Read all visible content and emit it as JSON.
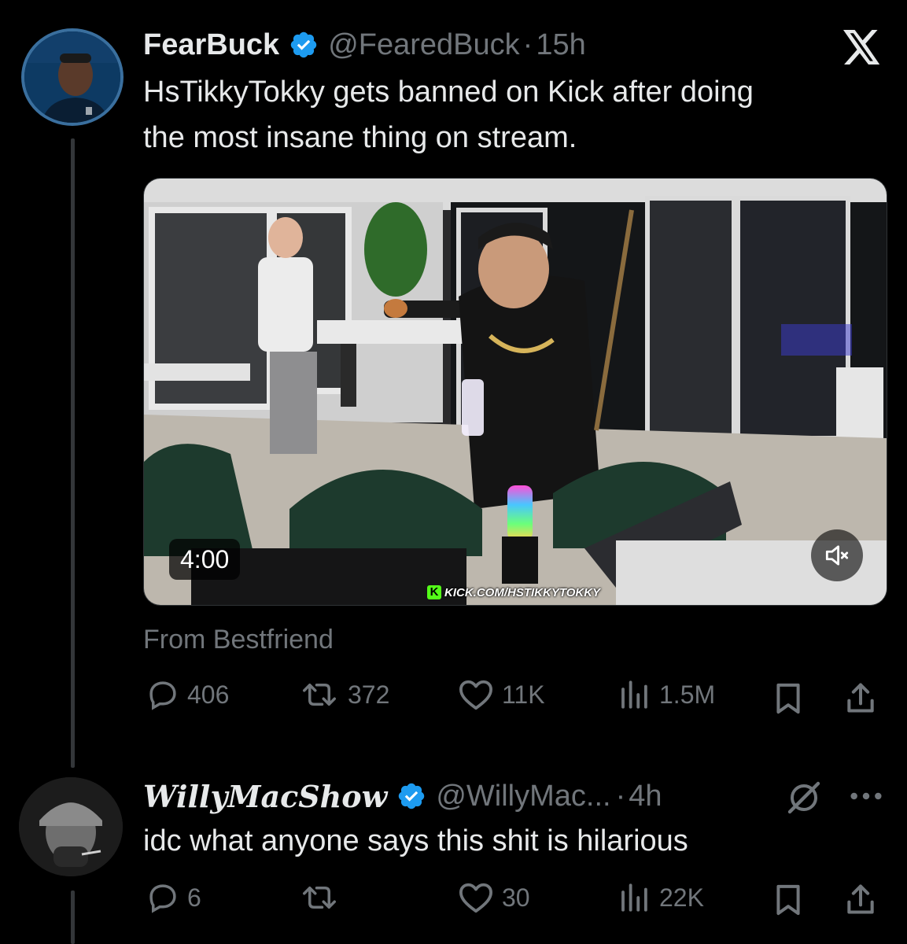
{
  "tweet": {
    "display_name": "FearBuck",
    "handle": "@FearedBuck",
    "separator": "·",
    "time": "15h",
    "text_line1": "HsTikkyTokky gets banned on Kick after doing",
    "text_line2": "the most insane thing on stream.",
    "video_duration": "4:00",
    "watermark": "KICK.COM/HSTIKKYTOKKY",
    "from_label": "From Bestfriend",
    "replies": "406",
    "reposts": "372",
    "likes": "11K",
    "views": "1.5M"
  },
  "reply": {
    "display_name": "WillyMacShow",
    "handle": "@WillyMac...",
    "separator": "·",
    "time": "4h",
    "text": "idc what anyone says this shit is hilarious",
    "replies": "6",
    "likes": "30",
    "views": "22K"
  },
  "colors": {
    "background": "#000000",
    "text_primary": "#e7e9ea",
    "text_secondary": "#71767b",
    "verified": "#1d9bf0"
  },
  "icons": [
    "x-logo-icon",
    "verified-badge-icon",
    "reply-icon",
    "repost-icon",
    "like-icon",
    "views-icon",
    "bookmark-icon",
    "share-icon",
    "mute-icon",
    "grok-icon",
    "more-icon"
  ]
}
